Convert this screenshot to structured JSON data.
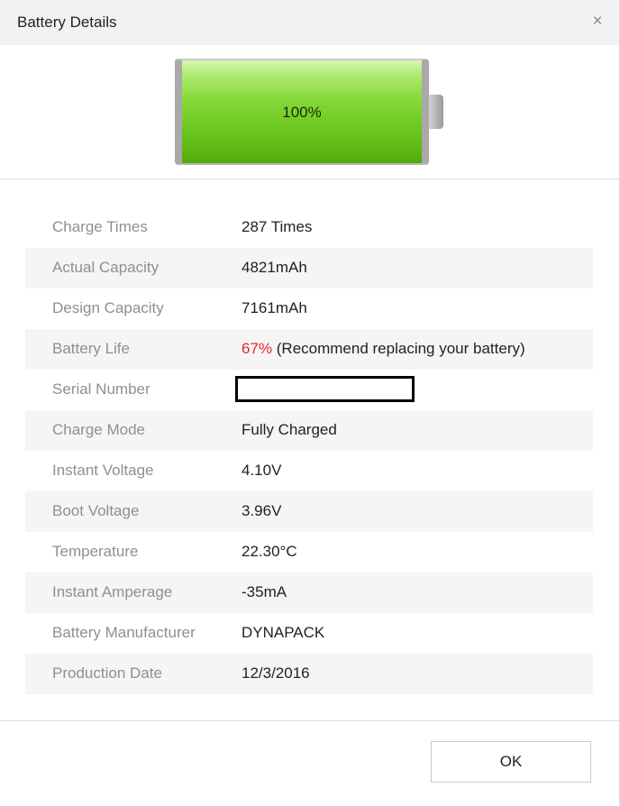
{
  "window": {
    "title": "Battery Details",
    "close_label": "×"
  },
  "battery": {
    "level": 1.0,
    "level_label": "100%",
    "fill_color": "#72cc24"
  },
  "details": [
    {
      "label": "Charge Times",
      "value": "287 Times"
    },
    {
      "label": "Actual Capacity",
      "value": "4821mAh"
    },
    {
      "label": "Design Capacity",
      "value": "7161mAh"
    },
    {
      "label": "Battery Life",
      "value_highlight": "67%",
      "value_note": " (Recommend replacing your battery)",
      "highlight_color": "#ee2222"
    },
    {
      "label": "Serial Number",
      "value": ""
    },
    {
      "label": "Charge Mode",
      "value": "Fully Charged"
    },
    {
      "label": "Instant Voltage",
      "value": "4.10V"
    },
    {
      "label": "Boot Voltage",
      "value": "3.96V"
    },
    {
      "label": "Temperature",
      "value": "22.30°C"
    },
    {
      "label": "Instant Amperage",
      "value": "-35mA"
    },
    {
      "label": "Battery Manufacturer",
      "value": "DYNAPACK"
    },
    {
      "label": "Production Date",
      "value": "12/3/2016"
    }
  ],
  "footer": {
    "ok_label": "OK"
  }
}
